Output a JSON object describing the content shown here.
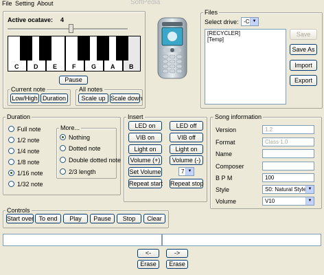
{
  "menu": {
    "file": "File",
    "setting": "Setting",
    "about": "About"
  },
  "watermark": "SoftPedia",
  "keyboard": {
    "active_octave_label": "Active ocatave:",
    "active_octave_value": "4",
    "white_keys": [
      "C",
      "D",
      "E",
      "F",
      "G",
      "A",
      "B"
    ],
    "pause_label": "Pause",
    "current_note": {
      "title": "Current note",
      "low_high": "Low/High",
      "duration": "Duration"
    },
    "all_notes": {
      "title": "All notes",
      "scale_up": "Scale up",
      "scale_down": "Scale down"
    }
  },
  "files": {
    "title": "Files",
    "select_drive_label": "Select drive:",
    "drive_value": "-C-",
    "list": [
      "[RECYCLER]",
      "[Temp]"
    ],
    "save": "Save",
    "save_as": "Save As",
    "import": "Import",
    "export": "Export"
  },
  "duration": {
    "title": "Duration",
    "options": [
      "Full note",
      "1/2 note",
      "1/4 note",
      "1/8 note",
      "1/16 note",
      "1/32 note"
    ],
    "selected": "1/16 note",
    "more": {
      "title": "More...",
      "options": [
        "Nothing",
        "Dotted note",
        "Double dotted note",
        "2/3 length"
      ],
      "selected": "Nothing"
    }
  },
  "insert": {
    "title": "Insert",
    "led_on": "LED on",
    "led_off": "LED off",
    "vib_on": "VIB on",
    "vib_off": "VIB off",
    "light_on": "Light on",
    "light_off": "Light on",
    "volume_plus": "Volume (+)",
    "volume_minus": "Volume (-)",
    "set_volume": "Set Volume",
    "volume_value": "7",
    "repeat_start": "Repeat start",
    "repeat_stop": "Repeat stop"
  },
  "song": {
    "title": "Song information",
    "version_label": "Version",
    "version_value": "1.2",
    "format_label": "Format",
    "format_value": "Class 1.0",
    "name_label": "Name",
    "name_value": "",
    "composer_label": "Composer",
    "composer_value": "",
    "bpm_label": "B P M",
    "bpm_value": "100",
    "style_label": "Style",
    "style_value": "S0: Natural Style",
    "volume_label": "Volume",
    "volume_value": "V10"
  },
  "controls": {
    "title": "Controls",
    "buttons": [
      "Start over",
      "To end",
      "Play",
      "Pause",
      "Stop",
      "Clear"
    ]
  },
  "bottom": {
    "left_arrow": "<-",
    "right_arrow": "->",
    "erase_left": "Erase",
    "erase_right": "Erase"
  }
}
